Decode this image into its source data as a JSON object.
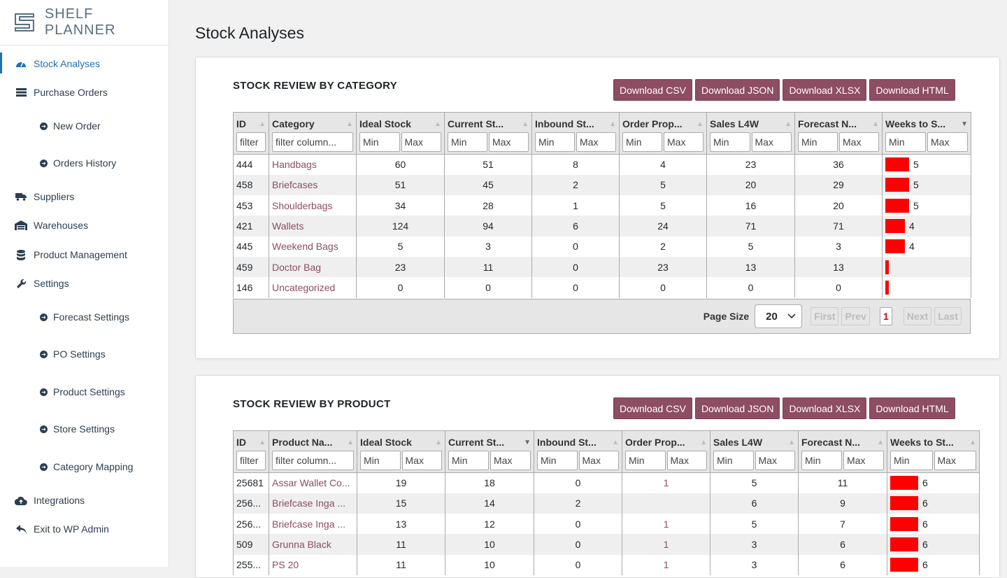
{
  "app": {
    "name": "SHELF PLANNER"
  },
  "sidebar": {
    "items": [
      {
        "label": "Stock Analyses",
        "icon": "dashboard-icon",
        "active": true
      },
      {
        "label": "Purchase Orders",
        "icon": "list-icon"
      },
      {
        "label": "New Order",
        "icon": "arrow-circle-icon",
        "sub": true
      },
      {
        "label": "Orders History",
        "icon": "arrow-circle-icon",
        "sub": true
      },
      {
        "label": "Suppliers",
        "icon": "truck-icon"
      },
      {
        "label": "Warehouses",
        "icon": "warehouse-icon"
      },
      {
        "label": "Product Management",
        "icon": "database-icon"
      },
      {
        "label": "Settings",
        "icon": "wrench-icon"
      },
      {
        "label": "Forecast Settings",
        "icon": "arrow-circle-icon",
        "sub": true
      },
      {
        "label": "PO Settings",
        "icon": "arrow-circle-icon",
        "sub": true
      },
      {
        "label": "Product Settings",
        "icon": "arrow-circle-icon",
        "sub": true
      },
      {
        "label": "Store Settings",
        "icon": "arrow-circle-icon",
        "sub": true
      },
      {
        "label": "Category Mapping",
        "icon": "arrow-circle-icon",
        "sub": true
      },
      {
        "label": "Integrations",
        "icon": "cloud-icon"
      },
      {
        "label": "Exit to WP Admin",
        "icon": "reply-icon"
      }
    ]
  },
  "page": {
    "title": "Stock Analyses"
  },
  "buttons": {
    "csv": "Download CSV",
    "json": "Download JSON",
    "xlsx": "Download XLSX",
    "html": "Download HTML"
  },
  "filters": {
    "text": "filter column...",
    "id": "filter",
    "min": "Min",
    "max": "Max"
  },
  "category_table": {
    "title": "STOCK REVIEW BY CATEGORY",
    "columns": [
      "ID",
      "Category",
      "Ideal Stock",
      "Current St...",
      "Inbound St...",
      "Order Prop...",
      "Sales L4W",
      "Forecast N...",
      "Weeks to S..."
    ],
    "rows": [
      {
        "id": "444",
        "name": "Handbags",
        "ideal": "60",
        "current": "51",
        "inbound": "8",
        "order": "4",
        "sales": "23",
        "forecast": "36",
        "weeks": "5",
        "weeks_fraction": 0.34
      },
      {
        "id": "458",
        "name": "Briefcases",
        "ideal": "51",
        "current": "45",
        "inbound": "2",
        "order": "5",
        "sales": "20",
        "forecast": "29",
        "weeks": "5",
        "weeks_fraction": 0.34
      },
      {
        "id": "453",
        "name": "Shoulderbags",
        "ideal": "34",
        "current": "28",
        "inbound": "1",
        "order": "5",
        "sales": "16",
        "forecast": "20",
        "weeks": "5",
        "weeks_fraction": 0.34
      },
      {
        "id": "421",
        "name": "Wallets",
        "ideal": "124",
        "current": "94",
        "inbound": "6",
        "order": "24",
        "sales": "71",
        "forecast": "71",
        "weeks": "4",
        "weeks_fraction": 0.28
      },
      {
        "id": "445",
        "name": "Weekend Bags",
        "ideal": "5",
        "current": "3",
        "inbound": "0",
        "order": "2",
        "sales": "5",
        "forecast": "3",
        "weeks": "4",
        "weeks_fraction": 0.28
      },
      {
        "id": "459",
        "name": "Doctor Bag",
        "ideal": "23",
        "current": "11",
        "inbound": "0",
        "order": "23",
        "sales": "13",
        "forecast": "13",
        "weeks": "",
        "weeks_fraction": 0.05
      },
      {
        "id": "146",
        "name": "Uncategorized",
        "ideal": "0",
        "current": "0",
        "inbound": "0",
        "order": "0",
        "sales": "0",
        "forecast": "0",
        "weeks": "",
        "weeks_fraction": 0.05
      }
    ],
    "pagination": {
      "page_size_label": "Page Size",
      "page_size": "20",
      "first": "First",
      "prev": "Prev",
      "current": "1",
      "next": "Next",
      "last": "Last"
    }
  },
  "product_table": {
    "title": "STOCK REVIEW BY PRODUCT",
    "columns": [
      "ID",
      "Product Na...",
      "Ideal Stock",
      "Current St...",
      "Inbound St...",
      "Order Prop...",
      "Sales L4W",
      "Forecast N...",
      "Weeks to St..."
    ],
    "rows": [
      {
        "id": "25681",
        "name": "Assar Wallet Co...",
        "ideal": "19",
        "current": "18",
        "inbound": "0",
        "order": "1",
        "sales": "5",
        "forecast": "11",
        "weeks": "6",
        "weeks_fraction": 0.4
      },
      {
        "id": "256...",
        "name": "Briefcase Inga ...",
        "ideal": "15",
        "current": "14",
        "inbound": "2",
        "order": "",
        "sales": "6",
        "forecast": "9",
        "weeks": "6",
        "weeks_fraction": 0.4
      },
      {
        "id": "256...",
        "name": "Briefcase Inga ...",
        "ideal": "13",
        "current": "12",
        "inbound": "0",
        "order": "1",
        "sales": "5",
        "forecast": "7",
        "weeks": "6",
        "weeks_fraction": 0.4
      },
      {
        "id": "509",
        "name": "Grunna Black",
        "ideal": "11",
        "current": "10",
        "inbound": "0",
        "order": "1",
        "sales": "3",
        "forecast": "6",
        "weeks": "6",
        "weeks_fraction": 0.4
      },
      {
        "id": "255...",
        "name": "PS 20",
        "ideal": "11",
        "current": "10",
        "inbound": "0",
        "order": "1",
        "sales": "3",
        "forecast": "6",
        "weeks": "6",
        "weeks_fraction": 0.4
      }
    ]
  },
  "colors": {
    "accent": "#8d4d63",
    "active_nav": "#2271b1",
    "bar": "#ff0000"
  }
}
